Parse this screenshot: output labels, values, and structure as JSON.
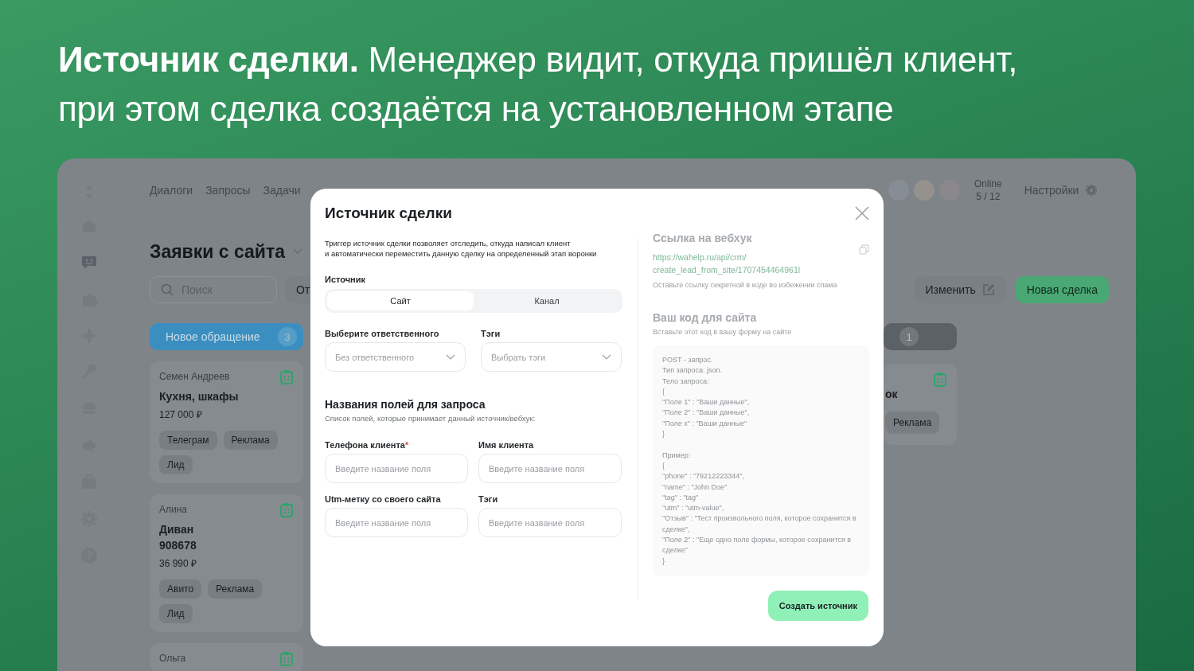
{
  "headline": "**Источник сделки.** Менеджер видит, откуда пришёл клиент, при этом сделка создаётся на установленном этапе",
  "app": {
    "sidebar": {
      "items": [
        {
          "selected": false
        },
        {
          "selected": true
        },
        {
          "selected": false
        },
        {
          "selected": false
        },
        {
          "selected": false
        },
        {
          "selected": false
        },
        {
          "selected": false
        },
        {
          "selected": false
        },
        {
          "selected": false
        },
        {
          "selected": false
        }
      ]
    },
    "nav": [
      "Диалоги",
      "Запросы",
      "Задачи"
    ],
    "online": {
      "label": "Online",
      "count": "5 / 12"
    },
    "settings_label": "Настройки",
    "board": {
      "title": "Заявки с сайта",
      "search_placeholder": "Поиск",
      "filter_button": "От",
      "edit_button": "Изменить",
      "new_deal_button": "Новая сделка"
    },
    "columns": [
      {
        "title": "Новое обращение",
        "count": "3",
        "color": "#3a8fc0",
        "cards": [
          {
            "name": "Семен Андреев",
            "title": "Кухня, шкафы",
            "price": "127 000 ₽",
            "tags": [
              "Телеграм",
              "Реклама",
              "Лид"
            ]
          },
          {
            "name": "Алина",
            "title": "Диван\n908678",
            "price": "36 990 ₽",
            "tags": [
              "Авито",
              "Реклама",
              "Лид"
            ]
          },
          {
            "name": "Ольга"
          }
        ]
      },
      {
        "count": "1",
        "color": "#5c6165",
        "cards": [
          {
            "title": "ок",
            "tags": [
              "Реклама"
            ]
          }
        ]
      }
    ]
  },
  "modal": {
    "title": "Источник сделки",
    "description": "Триггер источник сделки позволяет отследить, откуда написал клиент\nи автоматически переместить данную сделку на определенный этап воронки",
    "source_label": "Источник",
    "tabs": [
      {
        "label": "Сайт",
        "selected": true
      },
      {
        "label": "Канал",
        "selected": false
      }
    ],
    "selects": [
      {
        "label": "Выберите ответственного",
        "placeholder": "Без ответственного"
      },
      {
        "label": "Тэги",
        "placeholder": "Выбрать тэги"
      }
    ],
    "fields_title": "Названия полей для запроса",
    "fields_subtitle": "Список полей, которые принимает данный источник/вебхук:",
    "fields": [
      {
        "label": "Телефона клиента",
        "required_mark": "*",
        "placeholder": "Введите название поля"
      },
      {
        "label": "Имя клиента",
        "placeholder": "Введите название поля"
      },
      {
        "label": "Utm-метку со своего сайта",
        "placeholder": "Введите название поля"
      },
      {
        "label": "Тэги",
        "placeholder": "Введите название поля"
      }
    ],
    "webhook": {
      "title": "Ссылка на вебхук",
      "url": "https://wahelp.ru/api/crm/\ncreate_lead_from_site/1707454464961l",
      "note": "Оставьте ссылку секретной в коде во избежении спама"
    },
    "code": {
      "title": "Ваш код для сайта",
      "subtitle": "Вставьте этот код в вашу форму на сайте",
      "text": "POST - запрос.\nТип запроса: json.\nТело запроса:\n{\n\"Поле 1\" : \"Ваши данные\",\n\"Поле 2\" : \"Ваши данные\",\n\"Поле x\" : \"Ваши данные\"\n}\n\nПример:\n{\n\"phone\" : \"79212223344\",\n\"name\" : \"John Doe\"\n\"tag\" : \"tag\"\n\"utm\" : \"utm-value\",\n\"Отзыв\" : \"Тест произвольного поля, которое сохранится в сделке\",\n\"Поле 2\" : \"Еще одно поле формы, которое сохранится в сделке\"\n}"
    },
    "submit_button": "Создать источник"
  }
}
